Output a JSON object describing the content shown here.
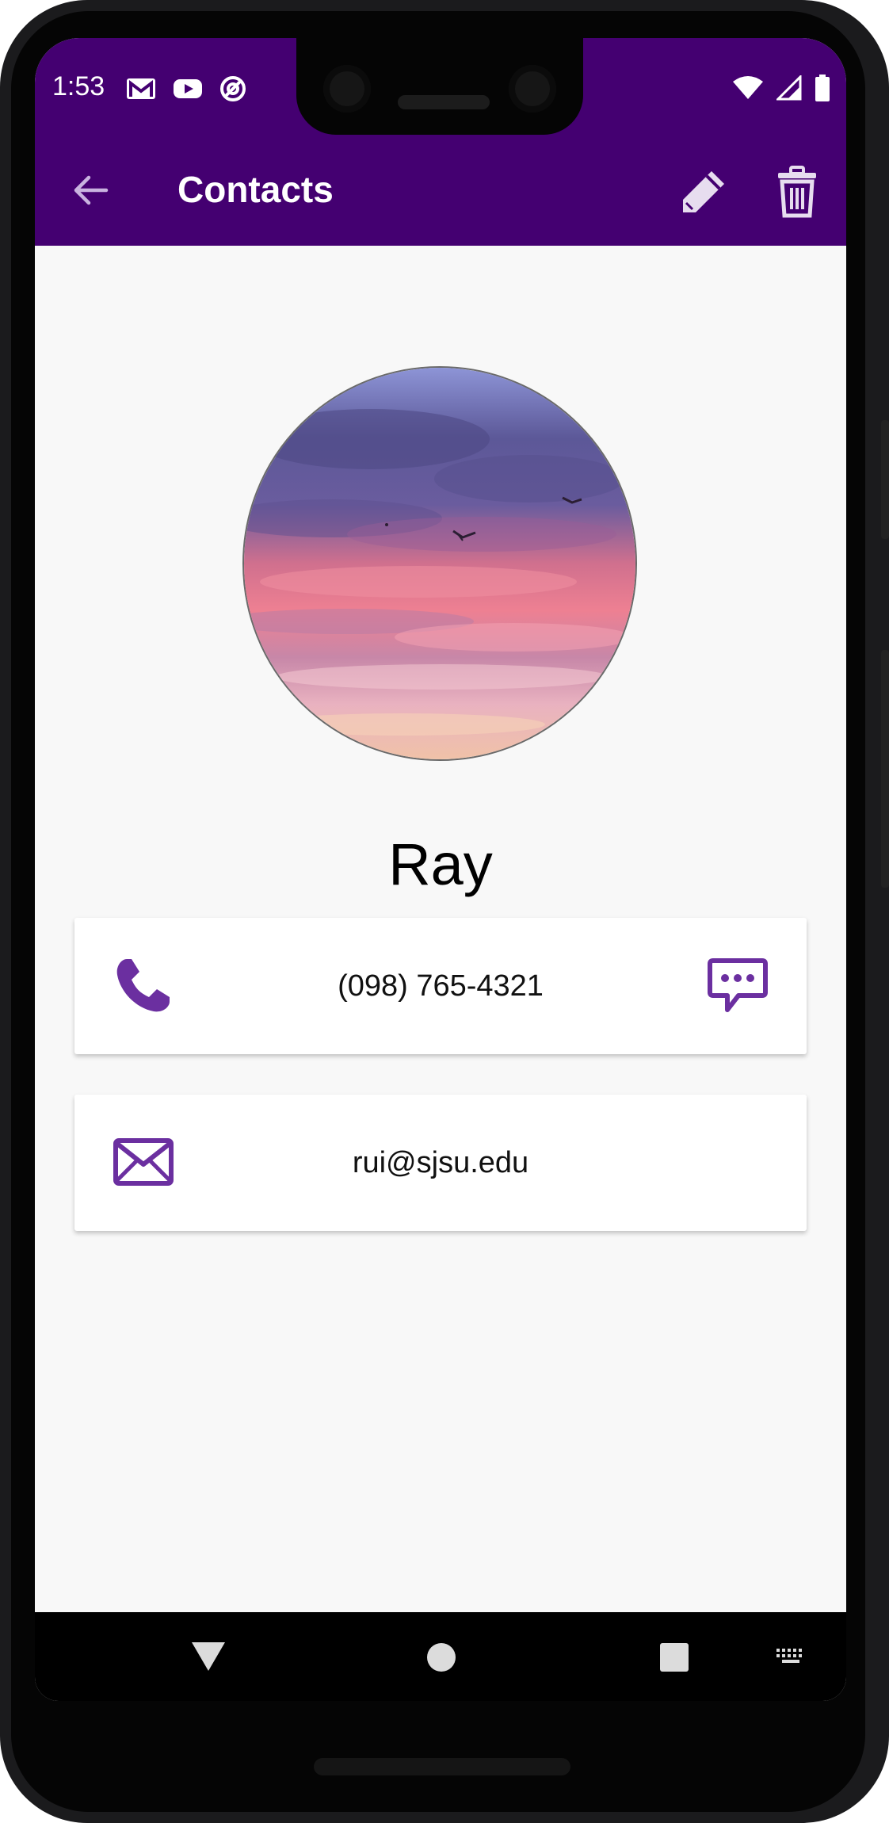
{
  "status_bar": {
    "time": "1:53",
    "notification_icons": [
      "gmail-icon",
      "youtube-icon",
      "data-saver-icon"
    ],
    "system_icons": [
      "wifi-icon",
      "signal-icon",
      "battery-icon"
    ]
  },
  "app_bar": {
    "title": "Contacts",
    "background_color": "#440071",
    "actions": [
      "edit-icon",
      "delete-icon"
    ]
  },
  "contact": {
    "name": "Ray",
    "phone": "(098) 765-4321",
    "email": "rui@sjsu.edu"
  },
  "colors": {
    "accent": "#6b2fa0",
    "screen_background": "#f8f8f8"
  },
  "nav_bar": {
    "buttons": [
      "back-triangle-icon",
      "home-circle-icon",
      "recents-square-icon",
      "keyboard-icon"
    ]
  }
}
